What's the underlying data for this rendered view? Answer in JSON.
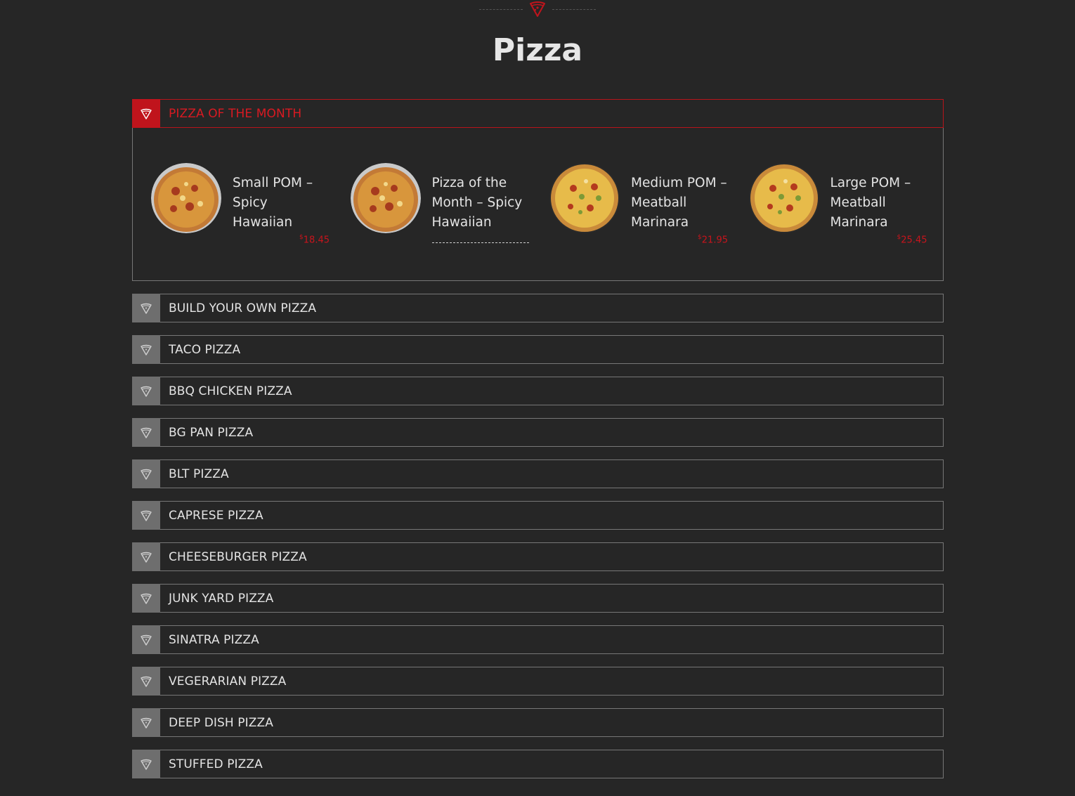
{
  "page": {
    "title": "Pizza"
  },
  "accordion": {
    "featured": {
      "label": "PIZZA OF THE MONTH",
      "products": [
        {
          "name": "Small POM – Spicy Hawaiian",
          "currency": "$",
          "price": "18.45",
          "image": "hawaiian-pizza"
        },
        {
          "name": "Pizza of the Month – Spicy Hawaiian",
          "currency": "",
          "price": "",
          "image": "hawaiian-pizza"
        },
        {
          "name": "Medium POM – Meatball Marinara",
          "currency": "$",
          "price": "21.95",
          "image": "marinara-pizza"
        },
        {
          "name": "Large POM – Meatball Marinara",
          "currency": "$",
          "price": "25.45",
          "image": "marinara-pizza"
        }
      ]
    },
    "sections": [
      "BUILD YOUR OWN PIZZA",
      "TACO PIZZA",
      "BBQ CHICKEN PIZZA",
      "BG PAN PIZZA",
      "BLT PIZZA",
      "CAPRESE PIZZA",
      "CHEESEBURGER PIZZA",
      "JUNK YARD PIZZA",
      "SINATRA PIZZA",
      "VEGERARIAN PIZZA",
      "DEEP DISH PIZZA",
      "STUFFED PIZZA"
    ]
  },
  "colors": {
    "accent": "#c0141c",
    "background": "#262626",
    "icon_bg": "#6e6e6e"
  },
  "icons": {
    "section": "pizza-slice-icon",
    "ornament": "pizza-slice-icon"
  }
}
